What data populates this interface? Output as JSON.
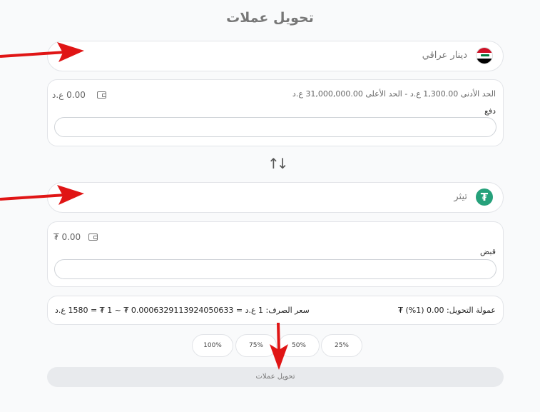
{
  "page_title": "تحويل عملات",
  "from": {
    "currency_name": "دينار عراقي",
    "limits_text": "الحد الأدنى 1,300.00 ع.د   -   الحد الأعلى 31,000,000.00 ع.د",
    "balance": "0.00 ع.د",
    "field_label": "دفع",
    "value": ""
  },
  "to": {
    "currency_name": "تيثر",
    "balance": "0.00 ₮",
    "field_label": "قبض",
    "value": ""
  },
  "rate_text": "سعر الصرف: 1 ع.د = 0.0006329113924050633 ₮ ~ 1 ₮ = 1580 ع.د",
  "fee_text": "عمولة التحويل: 0.00 (1%) ₮",
  "percent_buttons": [
    "25%",
    "50%",
    "75%",
    "100%"
  ],
  "submit_label": "تحويل عملات",
  "colors": {
    "accent_red": "#e01515",
    "tether_green": "#26a17b"
  },
  "icons": {
    "swap": "swap-arrows-icon",
    "wallet": "wallet-icon"
  }
}
